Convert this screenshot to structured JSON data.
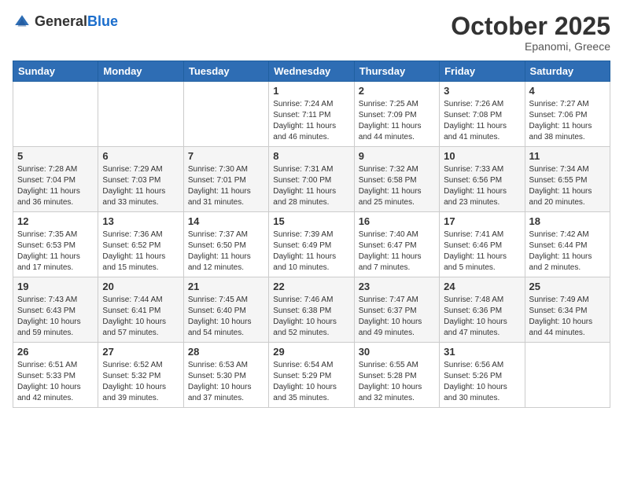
{
  "header": {
    "logo_general": "General",
    "logo_blue": "Blue",
    "month_title": "October 2025",
    "subtitle": "Epanomi, Greece"
  },
  "weekdays": [
    "Sunday",
    "Monday",
    "Tuesday",
    "Wednesday",
    "Thursday",
    "Friday",
    "Saturday"
  ],
  "weeks": [
    [
      {
        "day": "",
        "content": ""
      },
      {
        "day": "",
        "content": ""
      },
      {
        "day": "",
        "content": ""
      },
      {
        "day": "1",
        "content": "Sunrise: 7:24 AM\nSunset: 7:11 PM\nDaylight: 11 hours\nand 46 minutes."
      },
      {
        "day": "2",
        "content": "Sunrise: 7:25 AM\nSunset: 7:09 PM\nDaylight: 11 hours\nand 44 minutes."
      },
      {
        "day": "3",
        "content": "Sunrise: 7:26 AM\nSunset: 7:08 PM\nDaylight: 11 hours\nand 41 minutes."
      },
      {
        "day": "4",
        "content": "Sunrise: 7:27 AM\nSunset: 7:06 PM\nDaylight: 11 hours\nand 38 minutes."
      }
    ],
    [
      {
        "day": "5",
        "content": "Sunrise: 7:28 AM\nSunset: 7:04 PM\nDaylight: 11 hours\nand 36 minutes."
      },
      {
        "day": "6",
        "content": "Sunrise: 7:29 AM\nSunset: 7:03 PM\nDaylight: 11 hours\nand 33 minutes."
      },
      {
        "day": "7",
        "content": "Sunrise: 7:30 AM\nSunset: 7:01 PM\nDaylight: 11 hours\nand 31 minutes."
      },
      {
        "day": "8",
        "content": "Sunrise: 7:31 AM\nSunset: 7:00 PM\nDaylight: 11 hours\nand 28 minutes."
      },
      {
        "day": "9",
        "content": "Sunrise: 7:32 AM\nSunset: 6:58 PM\nDaylight: 11 hours\nand 25 minutes."
      },
      {
        "day": "10",
        "content": "Sunrise: 7:33 AM\nSunset: 6:56 PM\nDaylight: 11 hours\nand 23 minutes."
      },
      {
        "day": "11",
        "content": "Sunrise: 7:34 AM\nSunset: 6:55 PM\nDaylight: 11 hours\nand 20 minutes."
      }
    ],
    [
      {
        "day": "12",
        "content": "Sunrise: 7:35 AM\nSunset: 6:53 PM\nDaylight: 11 hours\nand 17 minutes."
      },
      {
        "day": "13",
        "content": "Sunrise: 7:36 AM\nSunset: 6:52 PM\nDaylight: 11 hours\nand 15 minutes."
      },
      {
        "day": "14",
        "content": "Sunrise: 7:37 AM\nSunset: 6:50 PM\nDaylight: 11 hours\nand 12 minutes."
      },
      {
        "day": "15",
        "content": "Sunrise: 7:39 AM\nSunset: 6:49 PM\nDaylight: 11 hours\nand 10 minutes."
      },
      {
        "day": "16",
        "content": "Sunrise: 7:40 AM\nSunset: 6:47 PM\nDaylight: 11 hours\nand 7 minutes."
      },
      {
        "day": "17",
        "content": "Sunrise: 7:41 AM\nSunset: 6:46 PM\nDaylight: 11 hours\nand 5 minutes."
      },
      {
        "day": "18",
        "content": "Sunrise: 7:42 AM\nSunset: 6:44 PM\nDaylight: 11 hours\nand 2 minutes."
      }
    ],
    [
      {
        "day": "19",
        "content": "Sunrise: 7:43 AM\nSunset: 6:43 PM\nDaylight: 10 hours\nand 59 minutes."
      },
      {
        "day": "20",
        "content": "Sunrise: 7:44 AM\nSunset: 6:41 PM\nDaylight: 10 hours\nand 57 minutes."
      },
      {
        "day": "21",
        "content": "Sunrise: 7:45 AM\nSunset: 6:40 PM\nDaylight: 10 hours\nand 54 minutes."
      },
      {
        "day": "22",
        "content": "Sunrise: 7:46 AM\nSunset: 6:38 PM\nDaylight: 10 hours\nand 52 minutes."
      },
      {
        "day": "23",
        "content": "Sunrise: 7:47 AM\nSunset: 6:37 PM\nDaylight: 10 hours\nand 49 minutes."
      },
      {
        "day": "24",
        "content": "Sunrise: 7:48 AM\nSunset: 6:36 PM\nDaylight: 10 hours\nand 47 minutes."
      },
      {
        "day": "25",
        "content": "Sunrise: 7:49 AM\nSunset: 6:34 PM\nDaylight: 10 hours\nand 44 minutes."
      }
    ],
    [
      {
        "day": "26",
        "content": "Sunrise: 6:51 AM\nSunset: 5:33 PM\nDaylight: 10 hours\nand 42 minutes."
      },
      {
        "day": "27",
        "content": "Sunrise: 6:52 AM\nSunset: 5:32 PM\nDaylight: 10 hours\nand 39 minutes."
      },
      {
        "day": "28",
        "content": "Sunrise: 6:53 AM\nSunset: 5:30 PM\nDaylight: 10 hours\nand 37 minutes."
      },
      {
        "day": "29",
        "content": "Sunrise: 6:54 AM\nSunset: 5:29 PM\nDaylight: 10 hours\nand 35 minutes."
      },
      {
        "day": "30",
        "content": "Sunrise: 6:55 AM\nSunset: 5:28 PM\nDaylight: 10 hours\nand 32 minutes."
      },
      {
        "day": "31",
        "content": "Sunrise: 6:56 AM\nSunset: 5:26 PM\nDaylight: 10 hours\nand 30 minutes."
      },
      {
        "day": "",
        "content": ""
      }
    ]
  ]
}
